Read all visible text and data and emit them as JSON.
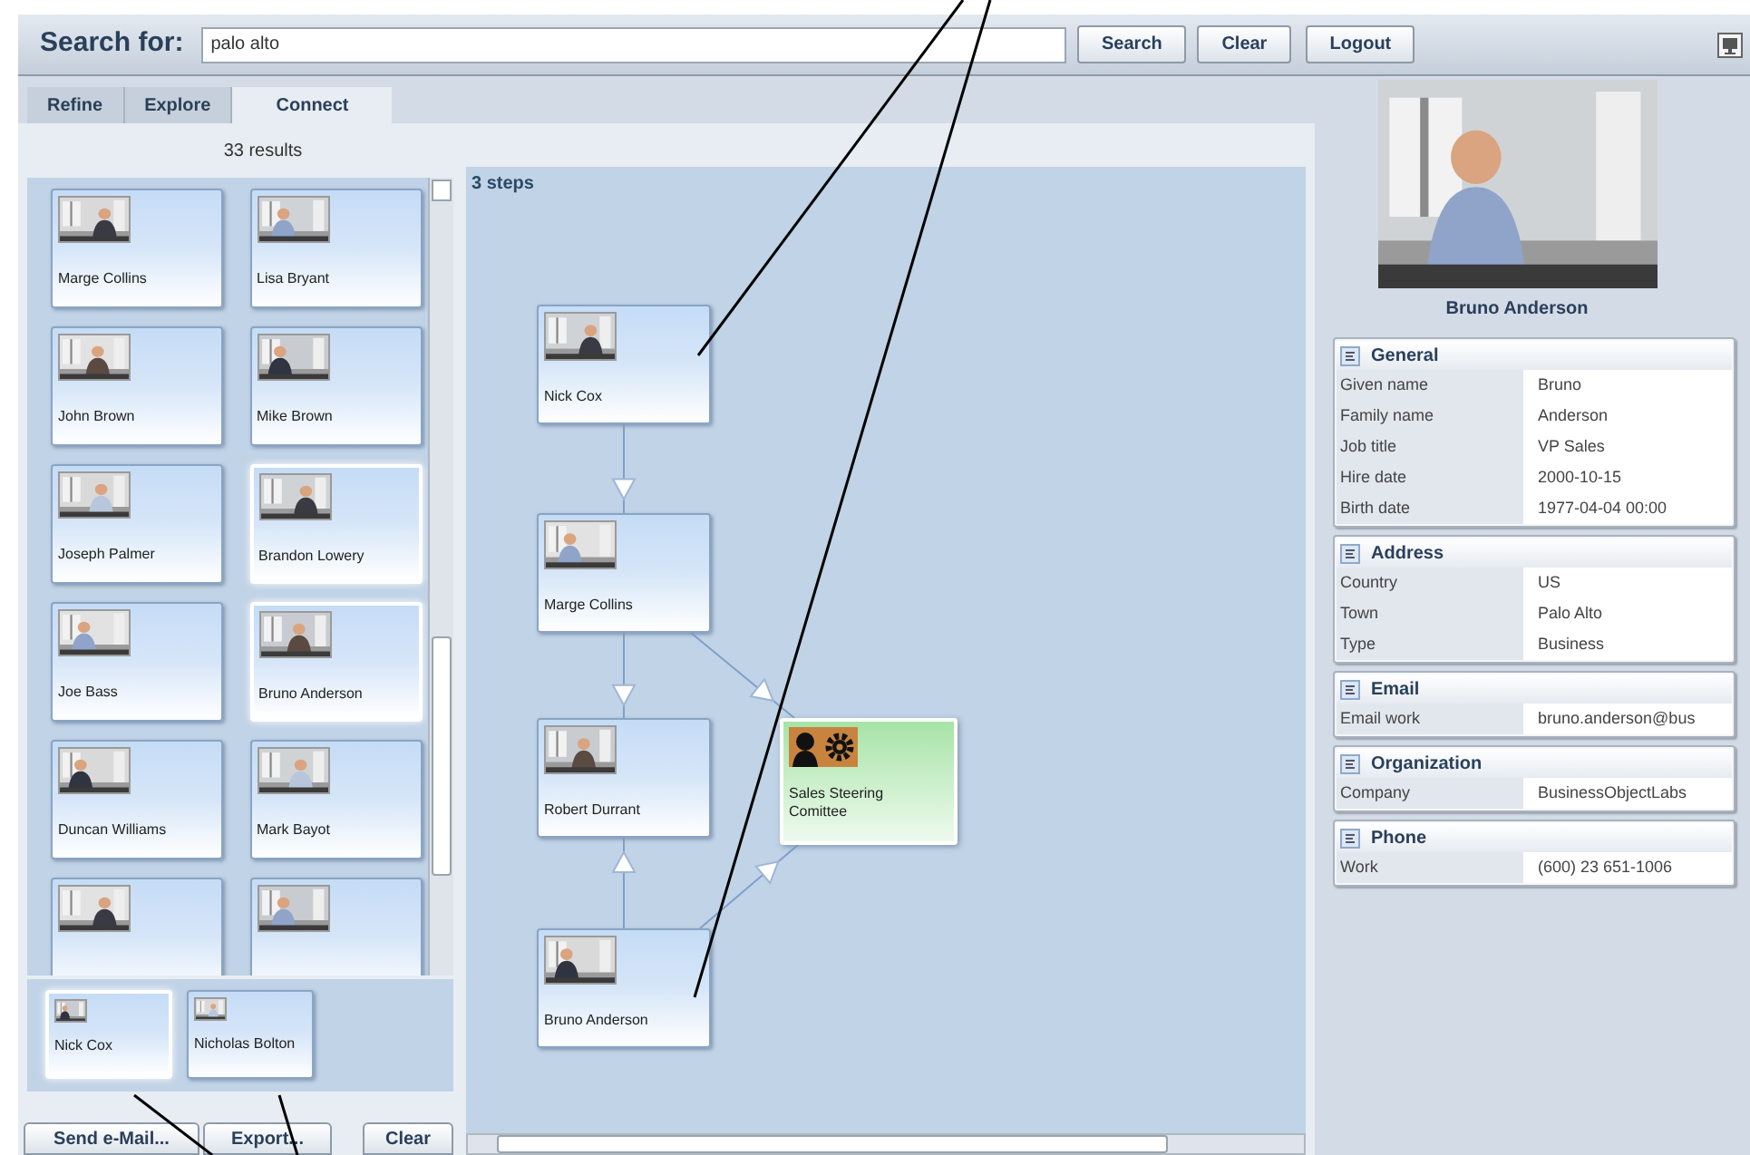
{
  "search": {
    "label": "Search for:",
    "value": "palo alto"
  },
  "toolbar_buttons": [
    "Search",
    "Clear",
    "Logout"
  ],
  "tabs": [
    {
      "label": "Refine",
      "selected": false
    },
    {
      "label": "Explore",
      "selected": false
    },
    {
      "label": "Connect",
      "selected": true
    }
  ],
  "results": {
    "count": "33 results",
    "cards": [
      {
        "name": "Marge Collins",
        "highlighted": false
      },
      {
        "name": "Lisa Bryant",
        "highlighted": false
      },
      {
        "name": "John Brown",
        "highlighted": false
      },
      {
        "name": "Mike Brown",
        "highlighted": false
      },
      {
        "name": "Joseph Palmer",
        "highlighted": false
      },
      {
        "name": "Brandon Lowery",
        "highlighted": true
      },
      {
        "name": "Joe Bass",
        "highlighted": false
      },
      {
        "name": "Bruno Anderson",
        "highlighted": true
      },
      {
        "name": "Duncan Williams",
        "highlighted": false
      },
      {
        "name": "Mark Bayot",
        "highlighted": false
      },
      {
        "highlighted": false
      },
      {
        "highlighted": false
      }
    ]
  },
  "selection": {
    "cards": [
      {
        "name": "Nick Cox",
        "highlighted": true
      },
      {
        "name": "Nicholas Bolton",
        "highlighted": false
      }
    ]
  },
  "buttons": [
    "Send e-Mail...",
    "Export...",
    "Clear"
  ],
  "graph": {
    "title": "3 steps",
    "nodes": [
      {
        "name": "Nick Cox",
        "kind": "person"
      },
      {
        "name": "Marge Collins",
        "kind": "person"
      },
      {
        "name": "Robert Durrant",
        "kind": "person"
      },
      {
        "name": "Bruno Anderson",
        "kind": "person"
      },
      {
        "name": "Sales Steering Comittee",
        "kind": "group"
      }
    ]
  },
  "profile": {
    "name": "Bruno Anderson",
    "sections": [
      {
        "title": "General",
        "rows": [
          {
            "label": "Given name",
            "value": "Bruno"
          },
          {
            "label": "Family name",
            "value": "Anderson"
          },
          {
            "label": "Job title",
            "value": "VP Sales"
          },
          {
            "label": "Hire date",
            "value": "2000-10-15"
          },
          {
            "label": "Birth date",
            "value": "1977-04-04 00:00"
          }
        ]
      },
      {
        "title": "Address",
        "rows": [
          {
            "label": "Country",
            "value": "US"
          },
          {
            "label": "Town",
            "value": "Palo Alto"
          },
          {
            "label": "Type",
            "value": "Business"
          }
        ]
      },
      {
        "title": "Email",
        "rows": [
          {
            "label": "Email work",
            "value": "bruno.anderson@bus"
          }
        ]
      },
      {
        "title": "Organization",
        "rows": [
          {
            "label": "Company",
            "value": "BusinessObjectLabs"
          }
        ]
      },
      {
        "title": "Phone",
        "rows": [
          {
            "label": "Work",
            "value": "(600) 23 651-1006"
          }
        ]
      }
    ]
  }
}
